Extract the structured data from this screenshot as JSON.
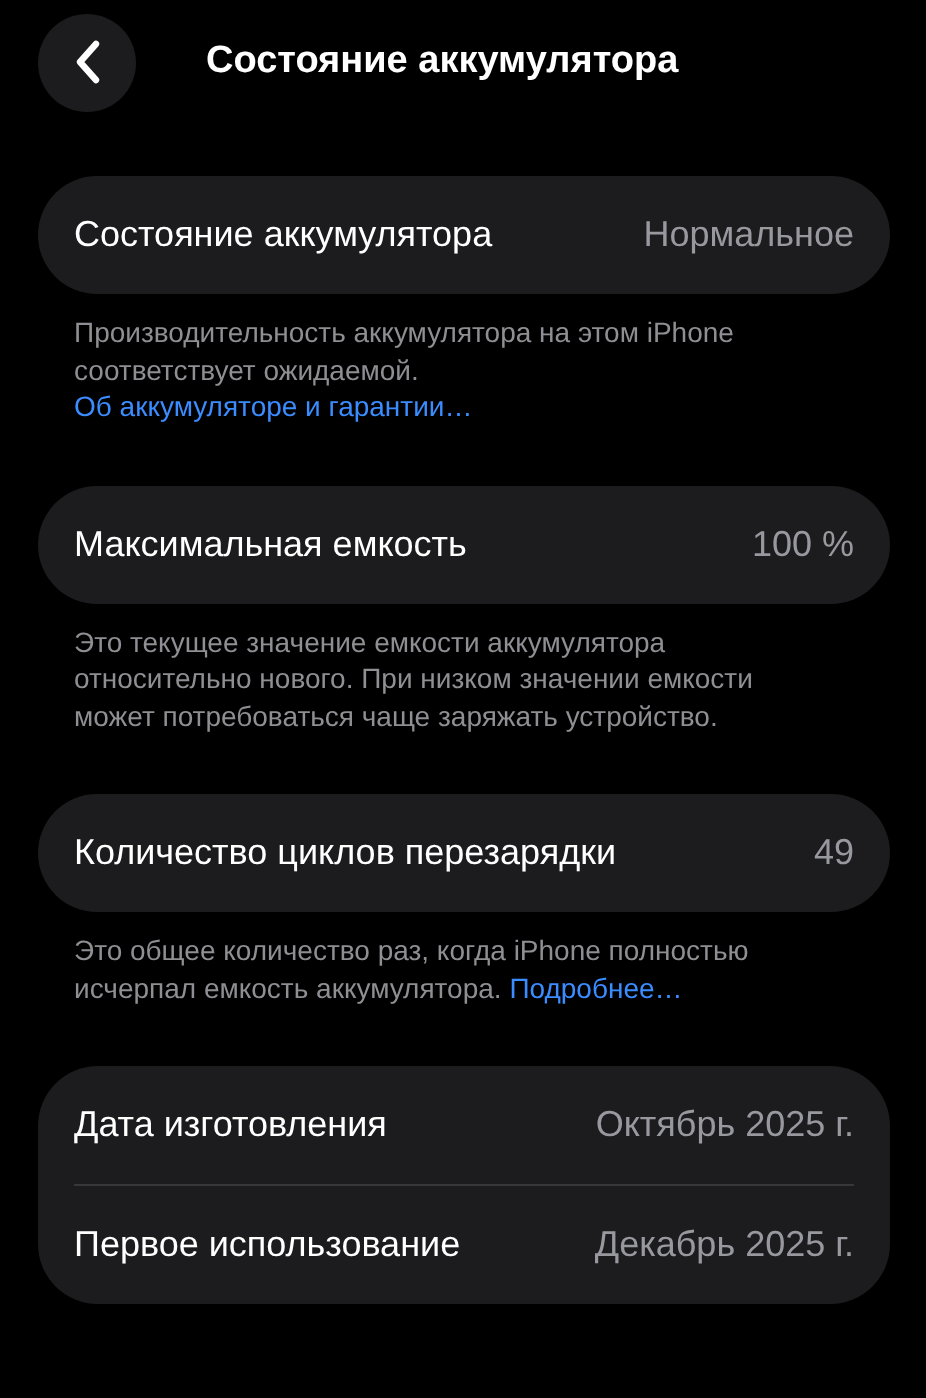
{
  "header": {
    "title": "Состояние аккумулятора"
  },
  "sections": [
    {
      "rows": [
        {
          "label": "Состояние аккумулятора",
          "value": "Нормальное"
        }
      ],
      "footer": {
        "text": "Производительность аккумулятора на этом iPhone соответствует ожидаемой.",
        "link": "Об аккумуляторе и гарантии…"
      }
    },
    {
      "rows": [
        {
          "label": "Максимальная емкость",
          "value": "100 %"
        }
      ],
      "footer": {
        "text": "Это текущее значение емкости аккумулятора относительно нового. При низком значении емкости может потребоваться чаще заряжать устройство."
      }
    },
    {
      "rows": [
        {
          "label": "Количество циклов перезарядки",
          "value": "49"
        }
      ],
      "footer": {
        "text": "Это общее количество раз, когда iPhone полностью исчерпал емкость аккумулятора.",
        "link": "Подробнее…"
      }
    },
    {
      "rows": [
        {
          "label": "Дата изготовления",
          "value": "Октябрь 2025 г."
        },
        {
          "label": "Первое использование",
          "value": "Декабрь 2025 г."
        }
      ]
    }
  ]
}
